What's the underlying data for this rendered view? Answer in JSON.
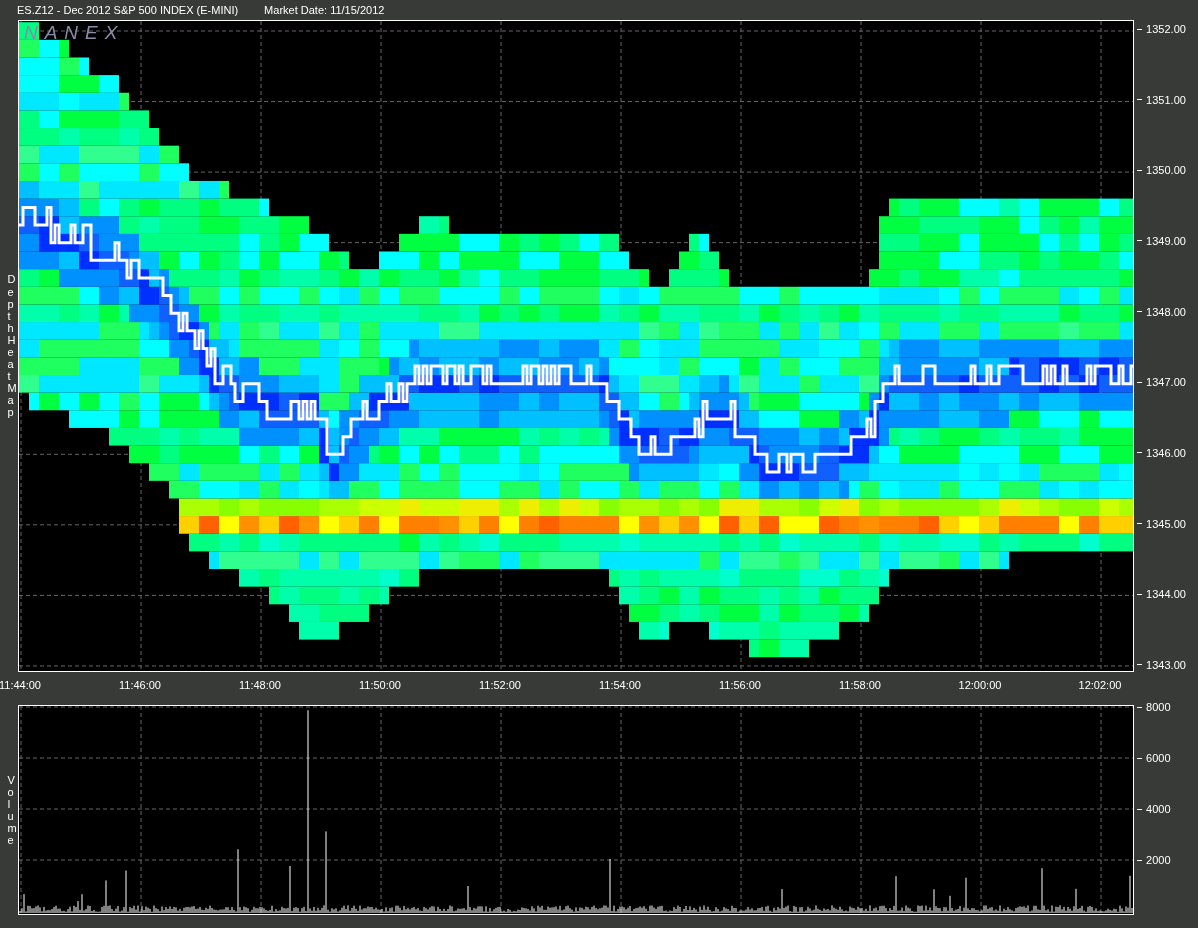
{
  "title": {
    "instrument": "ES.Z12 - Dec 2012 S&P 500 INDEX (E-MINI)",
    "market_date": "Market Date: 11/15/2012"
  },
  "heat_map_panel": {
    "logo": "NANEX",
    "axis_title": "Depth Heat Map",
    "price_ticks": [
      "1352.00",
      "1351.00",
      "1350.00",
      "1349.00",
      "1348.00",
      "1347.00",
      "1346.00",
      "1345.00",
      "1344.00",
      "1343.00"
    ],
    "time_ticks": [
      "11:44:00",
      "11:46:00",
      "11:48:00",
      "11:50:00",
      "11:52:00",
      "11:54:00",
      "11:56:00",
      "11:58:00",
      "12:00:00",
      "12:02:00"
    ]
  },
  "volume_panel": {
    "axis_title": "Volume",
    "volume_ticks": [
      "8000",
      "6000",
      "4000",
      "2000"
    ]
  }
}
